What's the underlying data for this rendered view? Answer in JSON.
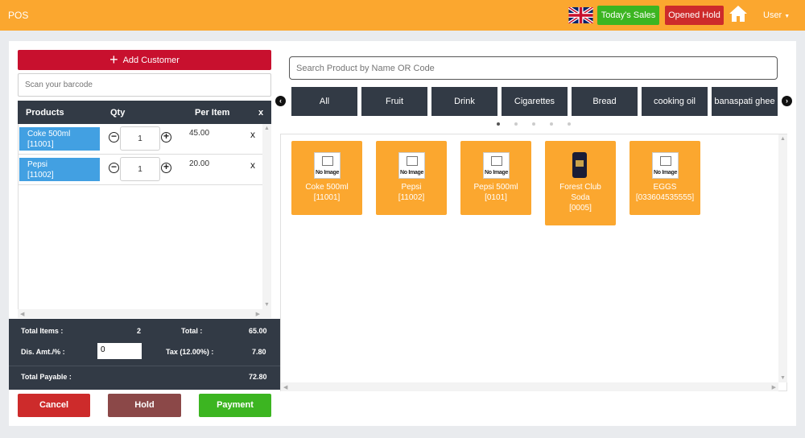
{
  "header": {
    "title": "POS",
    "todays_sales": "Today's Sales",
    "opened_hold": "Opened Hold",
    "user": "User"
  },
  "colors": {
    "accent": "#fba72f",
    "dark": "#323a45",
    "danger": "#cd2b2b",
    "success": "#3cb521",
    "product_tag": "#42a0e2"
  },
  "cart": {
    "add_customer": "Add Customer",
    "barcode_placeholder": "Scan your barcode",
    "columns": {
      "products": "Products",
      "qty": "Qty",
      "per_item": "Per Item",
      "remove": "x"
    },
    "items": [
      {
        "name": "Coke 500ml",
        "code": "[11001]",
        "qty": "1",
        "price": "45.00",
        "remove": "x"
      },
      {
        "name": "Pepsi",
        "code": "[11002]",
        "qty": "1",
        "price": "20.00",
        "remove": "x"
      }
    ]
  },
  "summary": {
    "total_items_label": "Total Items :",
    "total_items": "2",
    "total_label": "Total :",
    "total": "65.00",
    "discount_label": "Dis. Amt./% :",
    "discount_value": "0",
    "tax_label": "Tax (12.00%) :",
    "tax": "7.80",
    "payable_label": "Total Payable :",
    "payable": "72.80"
  },
  "actions": {
    "cancel": "Cancel",
    "hold": "Hold",
    "payment": "Payment"
  },
  "catalog": {
    "search_placeholder": "Search Product by Name OR Code",
    "categories": [
      "All",
      "Fruit",
      "Drink",
      "Cigarettes",
      "Bread",
      "cooking oil",
      "banaspati ghee"
    ],
    "no_image_label": "No Image",
    "products": [
      {
        "line1": "Coke 500ml",
        "line2": "[11001]",
        "line3": "",
        "image": "no-image"
      },
      {
        "line1": "Pepsi",
        "line2": "[11002]",
        "line3": "",
        "image": "no-image"
      },
      {
        "line1": "Pepsi 500ml",
        "line2": "[0101]",
        "line3": "",
        "image": "no-image"
      },
      {
        "line1": "Forest Club",
        "line2": "Soda",
        "line3": "[0005]",
        "image": "soda-can"
      },
      {
        "line1": "EGGS",
        "line2": "[033604535555]",
        "line3": "",
        "image": "no-image"
      }
    ]
  }
}
